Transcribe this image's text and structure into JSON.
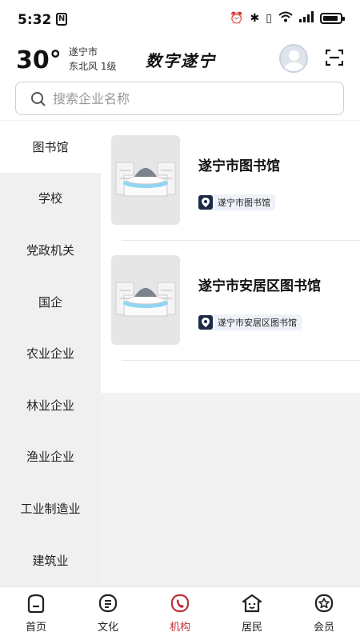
{
  "status": {
    "time": "5:32",
    "nfc": "N"
  },
  "header": {
    "temperature": "30°",
    "city": "遂宁市",
    "wind": "东北风  1级",
    "app_title": "数字遂宁"
  },
  "search": {
    "placeholder": "搜索企业名称"
  },
  "sidebar": {
    "items": [
      {
        "label": "图书馆",
        "active": true
      },
      {
        "label": "学校"
      },
      {
        "label": "党政机关"
      },
      {
        "label": "国企"
      },
      {
        "label": "农业企业"
      },
      {
        "label": "林业企业"
      },
      {
        "label": "渔业企业"
      },
      {
        "label": "工业制造业"
      },
      {
        "label": "建筑业"
      }
    ]
  },
  "cards": [
    {
      "title": "遂宁市图书馆",
      "tag": "遂宁市图书馆"
    },
    {
      "title": "遂宁市安居区图书馆",
      "tag": "遂宁市安居区图书馆"
    }
  ],
  "tabbar": {
    "items": [
      {
        "label": "首页",
        "icon": "home-icon"
      },
      {
        "label": "文化",
        "icon": "culture-icon"
      },
      {
        "label": "机构",
        "icon": "institution-icon",
        "active": true
      },
      {
        "label": "居民",
        "icon": "resident-icon"
      },
      {
        "label": "会员",
        "icon": "member-icon"
      }
    ],
    "accent": "#c0303a"
  }
}
